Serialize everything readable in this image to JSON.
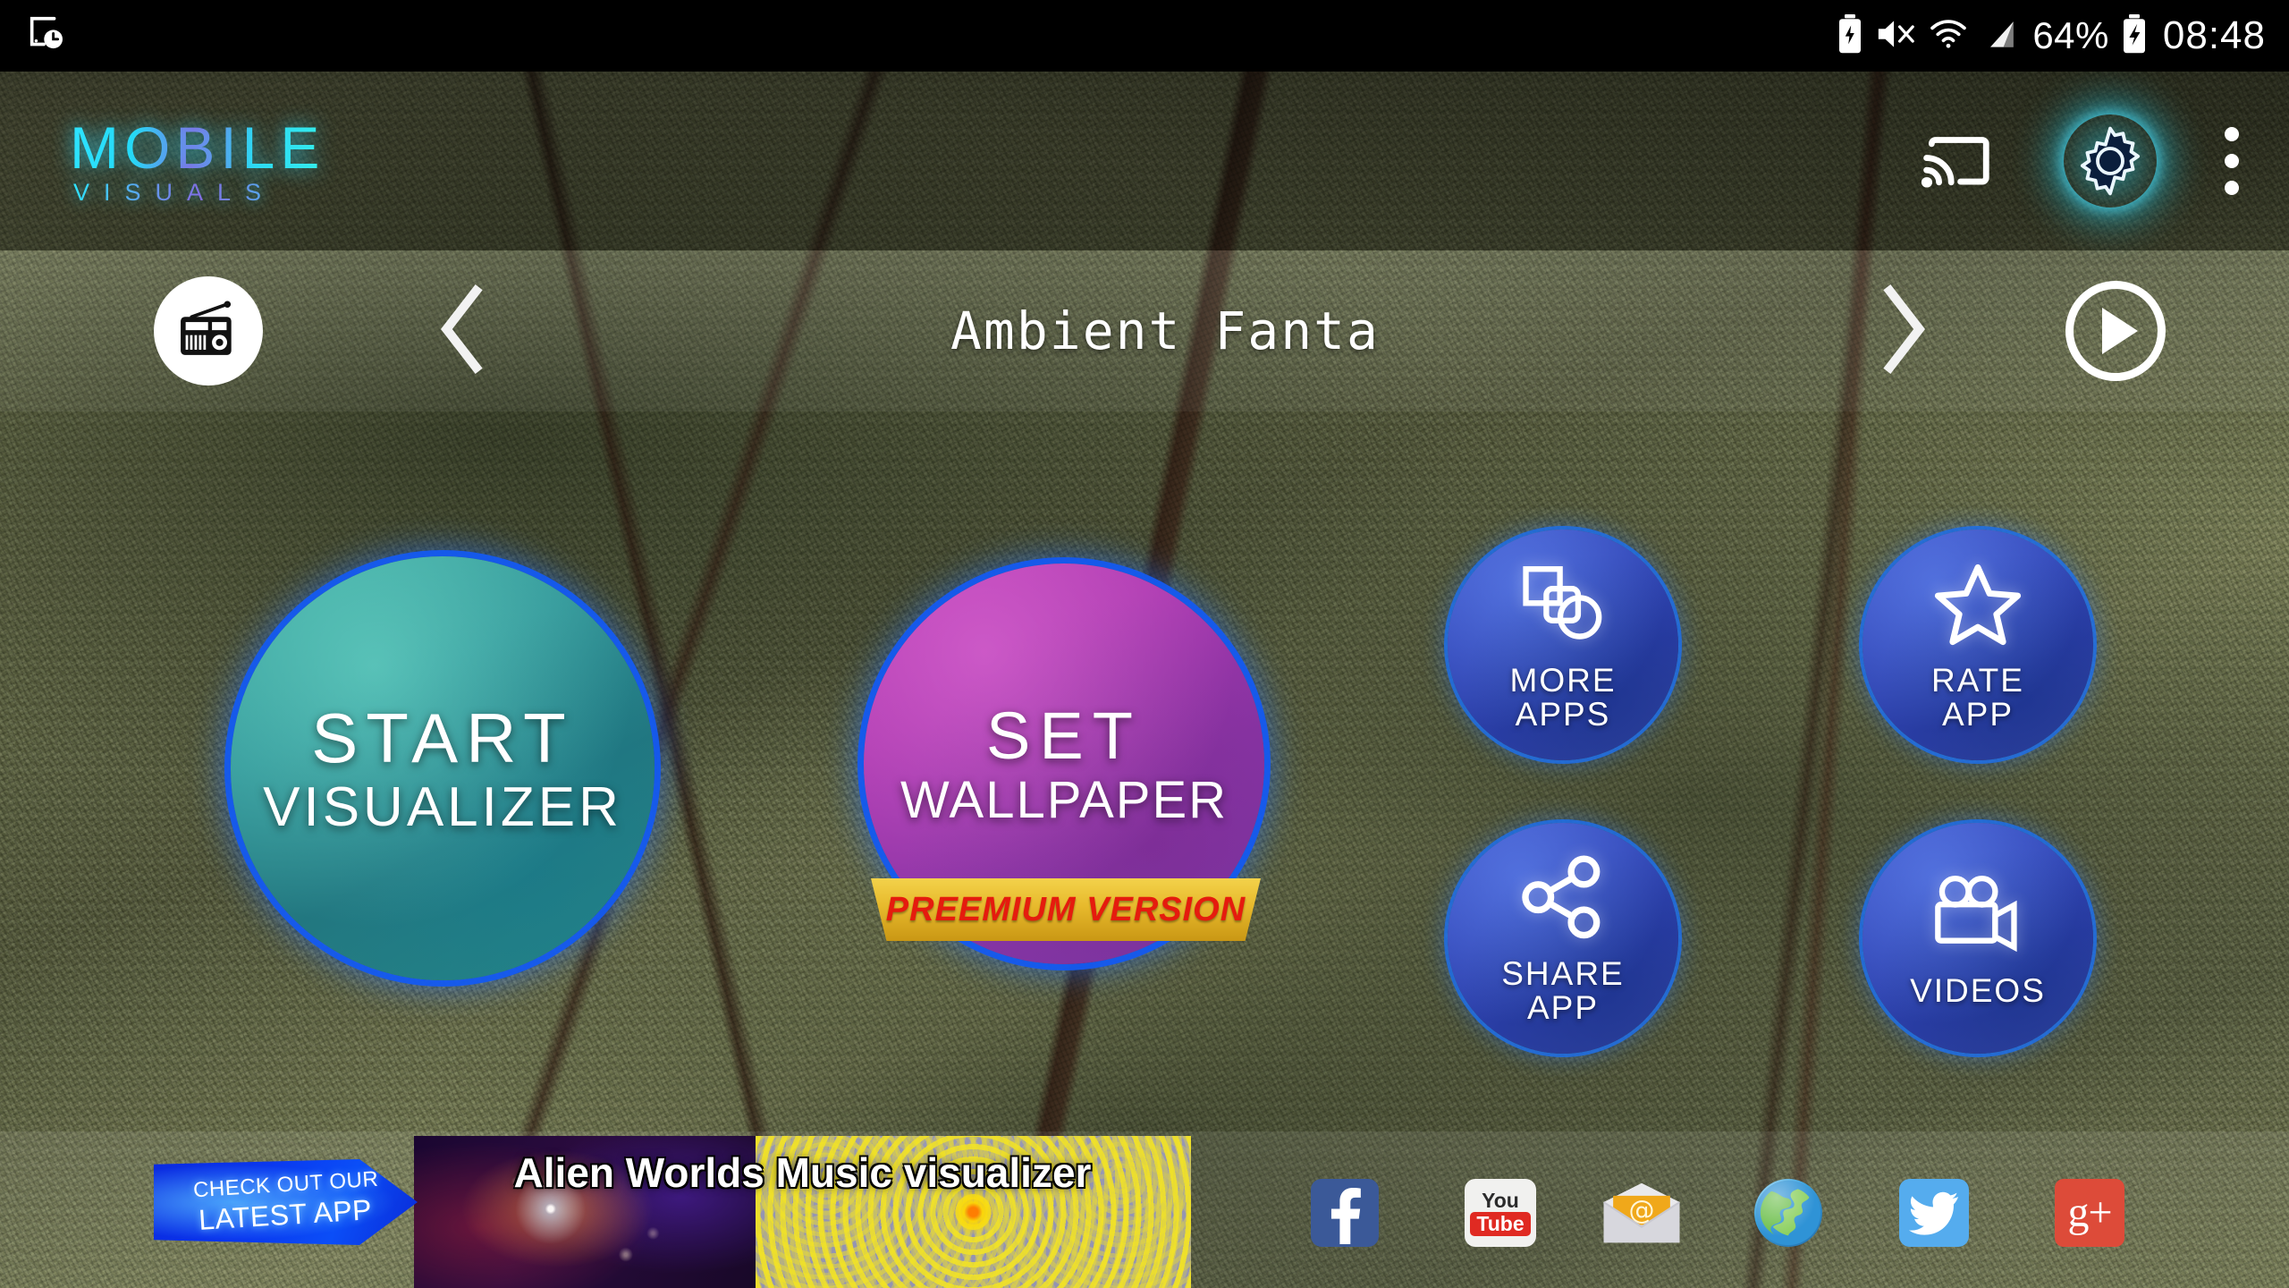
{
  "status_bar": {
    "left_icon": "screen-timeout-icon",
    "icons": [
      "battery-saver-icon",
      "mute-icon",
      "wifi-icon",
      "signal-icon"
    ],
    "battery_percent": "64%",
    "charging_icon": "charging-bolt-icon",
    "time": "08:48"
  },
  "header": {
    "logo_line1": "MOBILE",
    "logo_line2": "VISUALS",
    "cast_icon": "cast-icon",
    "settings_icon": "gear-icon",
    "overflow_icon": "more-vertical-icon"
  },
  "preset_bar": {
    "radio_icon": "radio-icon",
    "prev_icon": "chevron-left-icon",
    "preset_name": "Ambient Fanta",
    "next_icon": "chevron-right-icon",
    "play_icon": "play-circle-icon"
  },
  "main": {
    "start": {
      "line1": "START",
      "line2": "VISUALIZER"
    },
    "wallpaper": {
      "line1": "SET",
      "line2": "WALLPAPER",
      "ribbon": "PREEMIUM VERSION"
    },
    "tiles": [
      {
        "id": "more-apps",
        "icon": "shapes-icon",
        "line1": "MORE",
        "line2": "APPS"
      },
      {
        "id": "rate-app",
        "icon": "star-icon",
        "line1": "RATE",
        "line2": "APP"
      },
      {
        "id": "share-app",
        "icon": "share-icon",
        "line1": "SHARE",
        "line2": "APP"
      },
      {
        "id": "videos",
        "icon": "video-camera-icon",
        "line1": "VIDEOS",
        "line2": ""
      }
    ]
  },
  "bottom": {
    "latest_app_line1": "CHECK OUT OUR",
    "latest_app_line2": "LATEST APP",
    "promo_title": "Alien Worlds Music visualizer",
    "social": [
      {
        "id": "facebook",
        "label": "f"
      },
      {
        "id": "youtube",
        "label_top": "You",
        "label_bottom": "Tube"
      },
      {
        "id": "email",
        "label": "@"
      },
      {
        "id": "globe",
        "label": ""
      },
      {
        "id": "twitter",
        "label": ""
      },
      {
        "id": "gplus",
        "label": "g+"
      }
    ]
  },
  "colors": {
    "accent_cyan": "#2fe6ff",
    "start_circle": "#2f9296",
    "wallpaper_circle": "#a938ae",
    "tile_blue": "#3348b8",
    "ribbon_gold": "#e7b92c",
    "ribbon_text_red": "#e51b0e"
  }
}
